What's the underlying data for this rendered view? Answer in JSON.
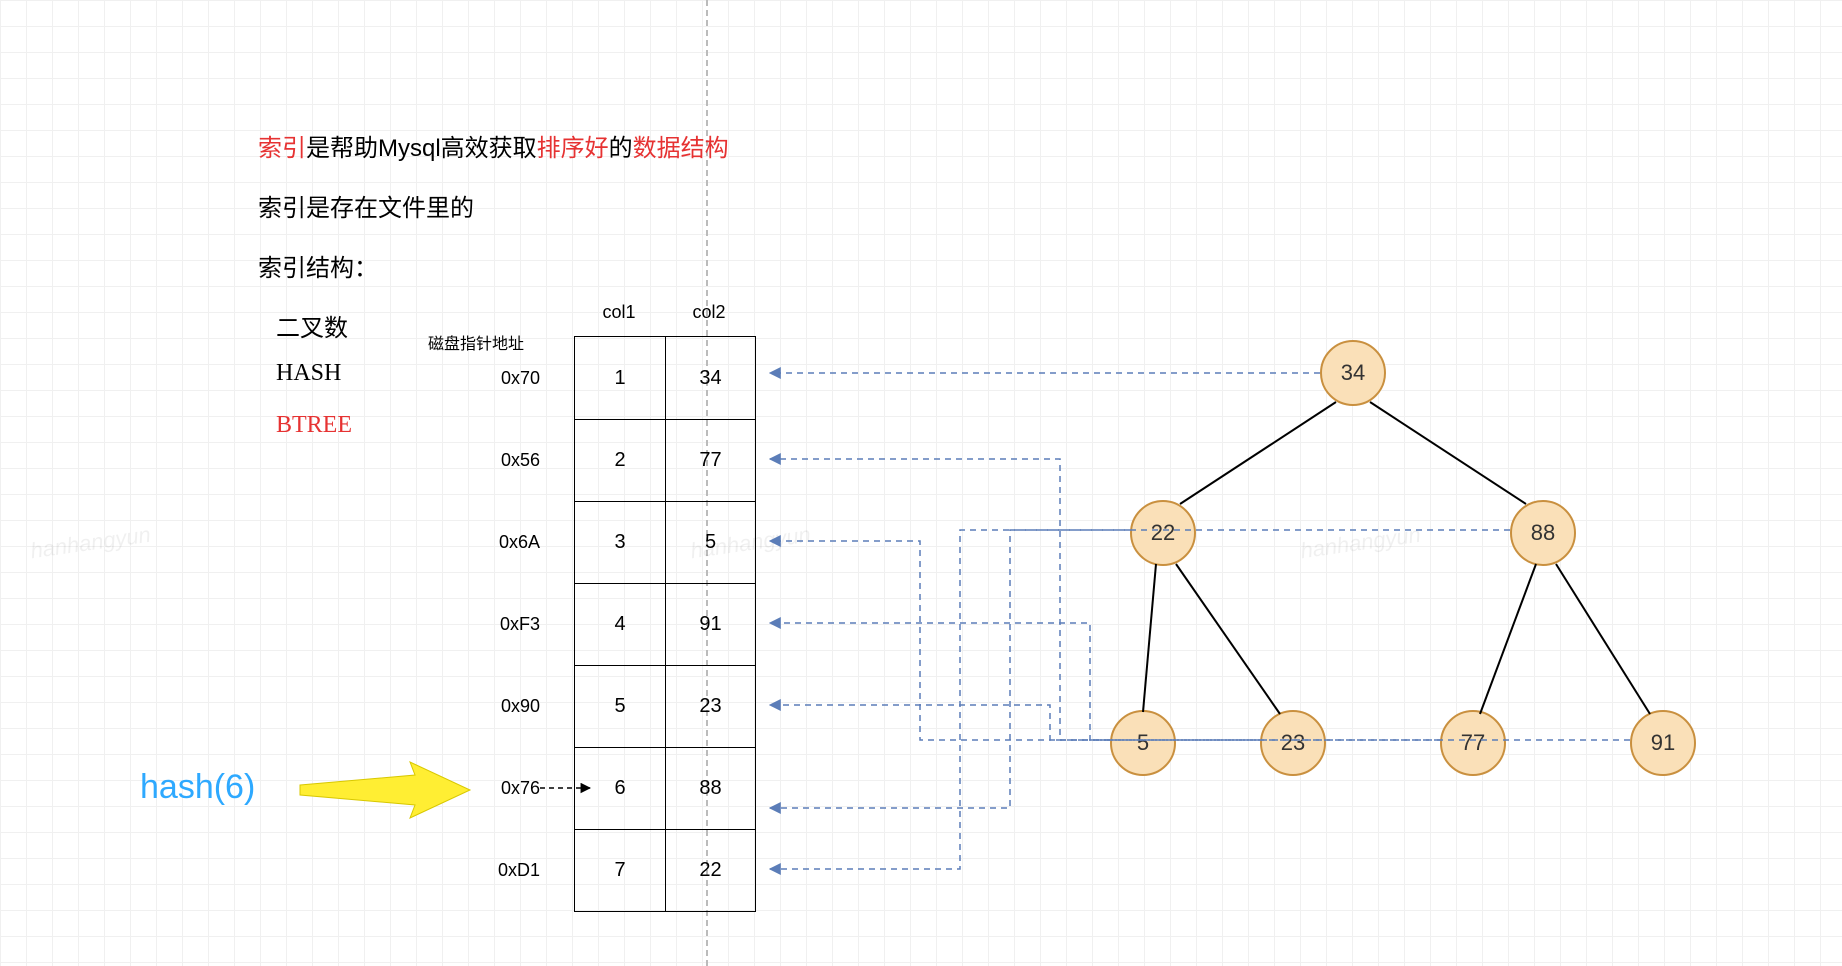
{
  "title_parts": {
    "p1": "索引",
    "p2": "是帮助Mysql高效获取",
    "p3": "排序好",
    "p4": "的",
    "p5": "数据结构"
  },
  "line2": "索引是存在文件里的",
  "line3": "索引结构：",
  "list": {
    "binary": "二叉数",
    "hash": "HASH",
    "btree": "BTREE"
  },
  "table": {
    "addr_header": "磁盘指针地址",
    "col1_header": "col1",
    "col2_header": "col2",
    "rows": [
      {
        "addr": "0x70",
        "col1": "1",
        "col2": "34"
      },
      {
        "addr": "0x56",
        "col1": "2",
        "col2": "77"
      },
      {
        "addr": "0x6A",
        "col1": "3",
        "col2": "5"
      },
      {
        "addr": "0xF3",
        "col1": "4",
        "col2": "91"
      },
      {
        "addr": "0x90",
        "col1": "5",
        "col2": "23"
      },
      {
        "addr": "0x76",
        "col1": "6",
        "col2": "88"
      },
      {
        "addr": "0xD1",
        "col1": "7",
        "col2": "22"
      }
    ]
  },
  "hash_label": "hash(6)",
  "tree": {
    "root": "34",
    "l": "22",
    "r": "88",
    "ll": "5",
    "lr": "23",
    "rl": "77",
    "rr": "91"
  },
  "watermark": "hanhangyun"
}
